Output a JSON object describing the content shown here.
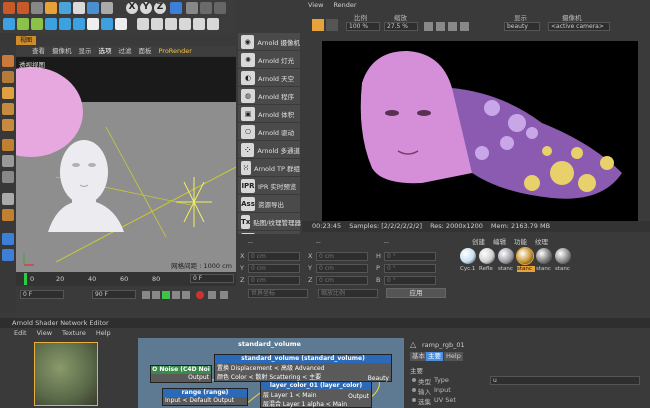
{
  "main_toolbar": {
    "axis_labels": [
      "X",
      "Y",
      "Z"
    ]
  },
  "viewport_left": {
    "tab_label": "视图",
    "menu": [
      "查看",
      "摄像机",
      "显示",
      "选项",
      "过滤",
      "面板",
      "ProRender"
    ],
    "title": "透视视图",
    "grid_info": "网格间距 : 1000 cm"
  },
  "arnold_menu": {
    "items": [
      {
        "icon": "camera-icon",
        "glyph": "◉",
        "label": "Arnold 摄像机"
      },
      {
        "icon": "light-icon",
        "glyph": "✺",
        "label": "Arnold 灯光"
      },
      {
        "icon": "sky-icon",
        "glyph": "◐",
        "label": "Arnold 天空"
      },
      {
        "icon": "procedural-icon",
        "glyph": "◍",
        "label": "Arnold 程序"
      },
      {
        "icon": "volume-icon",
        "glyph": "▣",
        "label": "Arnold 体积"
      },
      {
        "icon": "driver-icon",
        "glyph": "⎔",
        "label": "Arnold 驱动"
      },
      {
        "icon": "instance-icon",
        "glyph": "⁘",
        "label": "Arnold 多通道"
      },
      {
        "icon": "tp-group-icon",
        "glyph": "⁙",
        "label": "Arnold TP 群组"
      },
      {
        "icon": "ipr-icon",
        "glyph": "IPR",
        "label": "IPR 实时预览"
      },
      {
        "icon": "ass-icon",
        "glyph": "Ass",
        "label": "资源导出"
      },
      {
        "icon": "texture-manager-icon",
        "glyph": "Tx",
        "label": "贴图/纹理管理器"
      },
      {
        "icon": "flush-cache-icon",
        "glyph": "▤",
        "label": "刷新缓存"
      },
      {
        "icon": "help-icon",
        "glyph": "?",
        "label": "R站双语版"
      }
    ]
  },
  "render_view": {
    "menu": [
      "View",
      "Render"
    ],
    "labels": {
      "ratio": "比例",
      "zoom": "缩放",
      "display": "显示",
      "camera": "摄像机"
    },
    "values": {
      "ratio": "100 %",
      "zoom": "27.5 %",
      "display": "beauty",
      "camera": "<active camera>"
    },
    "status": {
      "time": "00:23:45",
      "samples": "Samples: [2/2/2/2/2/2]",
      "res": "Res: 2000x1200",
      "mem": "Mem: 2163.79 MB"
    }
  },
  "timeline": {
    "ticks": [
      "0",
      "20",
      "40",
      "60",
      "80"
    ],
    "frame_end_right": "0 F",
    "frame_start": "0 F",
    "frame_end": "90 F"
  },
  "coords": {
    "header": [
      "--",
      "--",
      "--"
    ],
    "rows": [
      {
        "a": "X",
        "b": "X",
        "c": "H"
      },
      {
        "a": "Y",
        "b": "Y",
        "c": "P"
      },
      {
        "a": "Z",
        "b": "Z",
        "c": "B"
      }
    ],
    "placeholder": "0 cm",
    "deg_placeholder": "0 °",
    "world": "世界坐标",
    "scale": "缩放比例",
    "apply": "应用"
  },
  "materials": {
    "menu": [
      "创建",
      "编辑",
      "功能",
      "纹理"
    ],
    "items": [
      "Cyc.1",
      "Refle",
      "stanc",
      "stanc",
      "stanc",
      "stanc"
    ]
  },
  "node_editor": {
    "title": "Arnold Shader Network Editor",
    "menu": [
      "Edit",
      "View",
      "Texture",
      "Help"
    ],
    "network_title": "standard_volume",
    "nodes": {
      "noise": {
        "title": "O Noise (C4D Noi",
        "port": "Output"
      },
      "volume": {
        "title": "standard_volume (standard_volume)",
        "line1": "置换 Displacement < 高级 Advanced",
        "line2": "颜色 Color < 散射 Scattering < 主要",
        "port": "Beauty"
      },
      "range": {
        "title": "range (range)",
        "line1": "Input < Default Output"
      },
      "layer": {
        "title": "layer_color_01 (layer_color)",
        "line1": "层 Layer 1 < Main",
        "line2": "层混合 Layer 1 alpha < Main",
        "port": "Output"
      }
    }
  },
  "attributes": {
    "node_name": "ramp_rgb_01",
    "tabs": [
      "基本",
      "主要",
      "Help"
    ],
    "section": "主要",
    "rows": [
      {
        "label": "类型",
        "eng": "Type",
        "value": "u"
      },
      {
        "label": "输入",
        "eng": "Input",
        "value": ""
      },
      {
        "label": "选集",
        "eng": "UV Set",
        "value": ""
      }
    ]
  }
}
